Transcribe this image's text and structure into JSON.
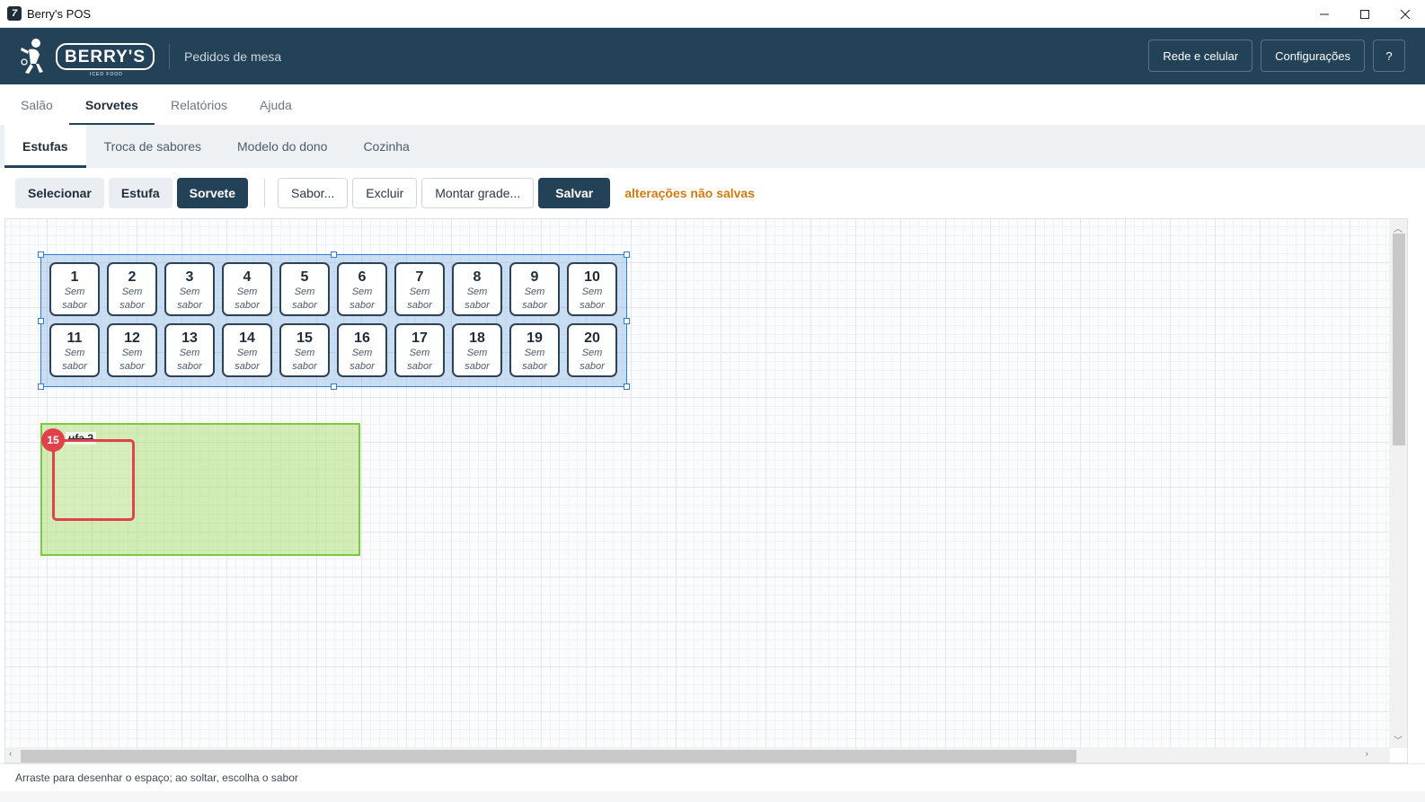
{
  "window": {
    "title": "Berry's POS",
    "controls": [
      "minimize",
      "maximize",
      "close"
    ]
  },
  "header": {
    "logo_text": "BERRY'S",
    "logo_subtext": "ICED FOOD",
    "subtitle": "Pedidos de mesa",
    "actions": [
      "Rede e celular",
      "Configurações",
      "?"
    ]
  },
  "main_tabs": [
    {
      "label": "Salão",
      "active": false
    },
    {
      "label": "Sorvetes",
      "active": true
    },
    {
      "label": "Relatórios",
      "active": false
    },
    {
      "label": "Ajuda",
      "active": false
    }
  ],
  "sub_tabs": [
    {
      "label": "Estufas",
      "active": true
    },
    {
      "label": "Troca de sabores",
      "active": false
    },
    {
      "label": "Modelo do dono",
      "active": false
    },
    {
      "label": "Cozinha",
      "active": false
    }
  ],
  "toolbar": {
    "modes": [
      {
        "label": "Selecionar",
        "active": false
      },
      {
        "label": "Estufa",
        "active": false
      },
      {
        "label": "Sorvete",
        "active": true
      }
    ],
    "sabor_label": "Sabor...",
    "excluir_label": "Excluir",
    "montar_label": "Montar grade...",
    "salvar_label": "Salvar",
    "unsaved_text": "alterações não salvas"
  },
  "canvas": {
    "estufa1": {
      "selected": true,
      "slot_empty_line1": "Sem",
      "slot_empty_line2": "sabor",
      "slots": [
        "1",
        "2",
        "3",
        "4",
        "5",
        "6",
        "7",
        "8",
        "9",
        "10",
        "11",
        "12",
        "13",
        "14",
        "15",
        "16",
        "17",
        "18",
        "19",
        "20"
      ]
    },
    "estufa2": {
      "label": "ufa 2",
      "drawing_count": "15"
    }
  },
  "status": {
    "hint": "Arraste para desenhar o espaço; ao soltar, escolha o sabor"
  },
  "colors": {
    "brand": "#234157",
    "selection": "#2f7fd0",
    "estufa2_fill": "#c7e6a4",
    "drawing": "#e0414b",
    "warning": "#d07a10"
  }
}
